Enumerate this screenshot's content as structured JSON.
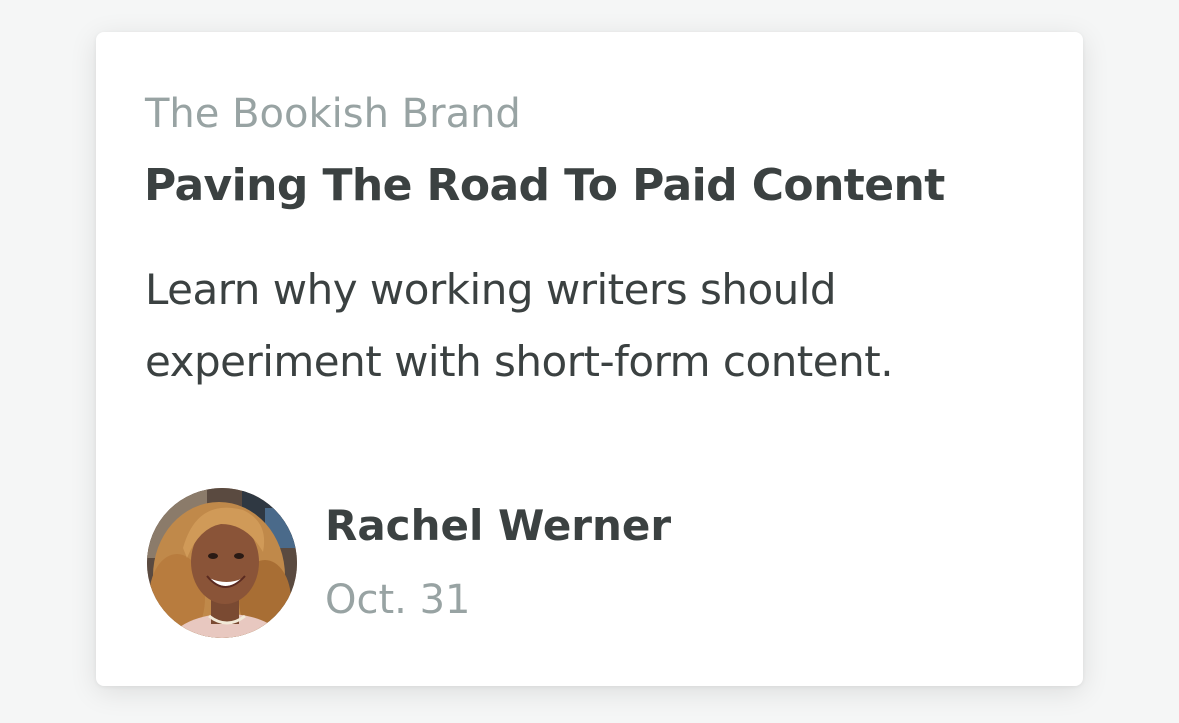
{
  "card": {
    "publication": "The Bookish Brand",
    "title": "Paving The Road To Paid Content",
    "subtitle": "Learn why working writers should experiment with short-form content.",
    "author": {
      "name": "Rachel Werner",
      "date": "Oct. 31",
      "avatar_icon": "author-photo"
    }
  },
  "colors": {
    "background": "#f5f6f6",
    "card": "#ffffff",
    "text_primary": "#3b4141",
    "text_muted": "#98a3a3"
  }
}
